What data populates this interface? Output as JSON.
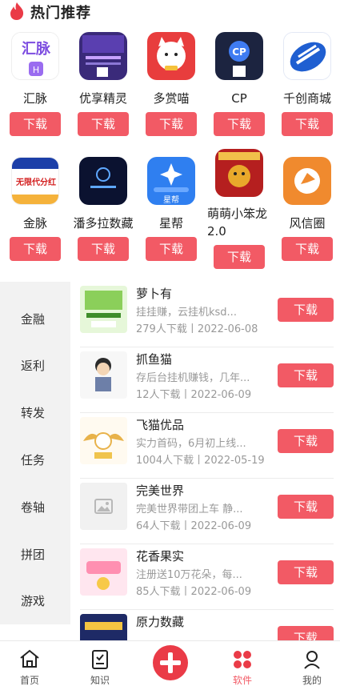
{
  "header": {
    "title": "热门推荐"
  },
  "colors": {
    "accent": "#f25a65",
    "menu_bg": "#f2f2f2"
  },
  "apps_row1": [
    {
      "name": "汇脉",
      "button": "下载",
      "icon": "huimai-logo"
    },
    {
      "name": "优享精灵",
      "button": "下载",
      "icon": "youxiang-poster"
    },
    {
      "name": "多赏喵",
      "button": "下载",
      "icon": "lucky-cat"
    },
    {
      "name": "CP",
      "button": "下载",
      "icon": "cp-logo"
    },
    {
      "name": "千创商城",
      "button": "下载",
      "icon": "qianchuang-logo"
    }
  ],
  "apps_row2": [
    {
      "name": "金脉",
      "button": "下载",
      "icon": "jinmai-banner",
      "icon_text": "无限代分红"
    },
    {
      "name": "潘多拉数藏",
      "button": "下载",
      "icon": "pandora-logo"
    },
    {
      "name": "星帮",
      "button": "下载",
      "icon": "xingbang-logo",
      "icon_text": "星帮"
    },
    {
      "name": "萌萌小笨龙2.0",
      "button": "下载",
      "icon": "dragon-poster"
    },
    {
      "name": "风信圈",
      "button": "下载",
      "icon": "fengxin-logo"
    }
  ],
  "categories": [
    "金融",
    "返利",
    "转发",
    "任务",
    "卷轴",
    "拼团",
    "游戏"
  ],
  "list": [
    {
      "title": "萝卜有",
      "desc": "挂挂赚，云挂机ksd...",
      "meta": "279人下载丨2022-06-08",
      "button": "下载",
      "thumb": "guaji-poster"
    },
    {
      "title": "抓鱼猫",
      "desc": "存后台挂机赚钱，几年...",
      "meta": "12人下载丨2022-06-09",
      "button": "下载",
      "thumb": "cartoon-man"
    },
    {
      "title": "飞猫优品",
      "desc": "实力首码，6月初上线...",
      "meta": "1004人下载丨2022-05-19",
      "button": "下载",
      "thumb": "flying-cat"
    },
    {
      "title": "完美世界",
      "desc": "完美世界带团上车 静...",
      "meta": "64人下载丨2022-06-09",
      "button": "下载",
      "thumb": "image-placeholder-icon"
    },
    {
      "title": "花香果实",
      "desc": "注册送10万花朵，每...",
      "meta": "85人下载丨2022-06-09",
      "button": "下载",
      "thumb": "flower-poster"
    },
    {
      "title": "原力数藏",
      "desc": "",
      "meta": "",
      "button": "下载",
      "thumb": "yuanli-poster"
    }
  ],
  "tabbar": [
    {
      "label": "首页",
      "icon": "home-icon"
    },
    {
      "label": "知识",
      "icon": "knowledge-icon"
    },
    {
      "label": "",
      "icon": "plus-icon"
    },
    {
      "label": "软件",
      "icon": "software-icon",
      "active": true
    },
    {
      "label": "我的",
      "icon": "profile-icon"
    }
  ]
}
